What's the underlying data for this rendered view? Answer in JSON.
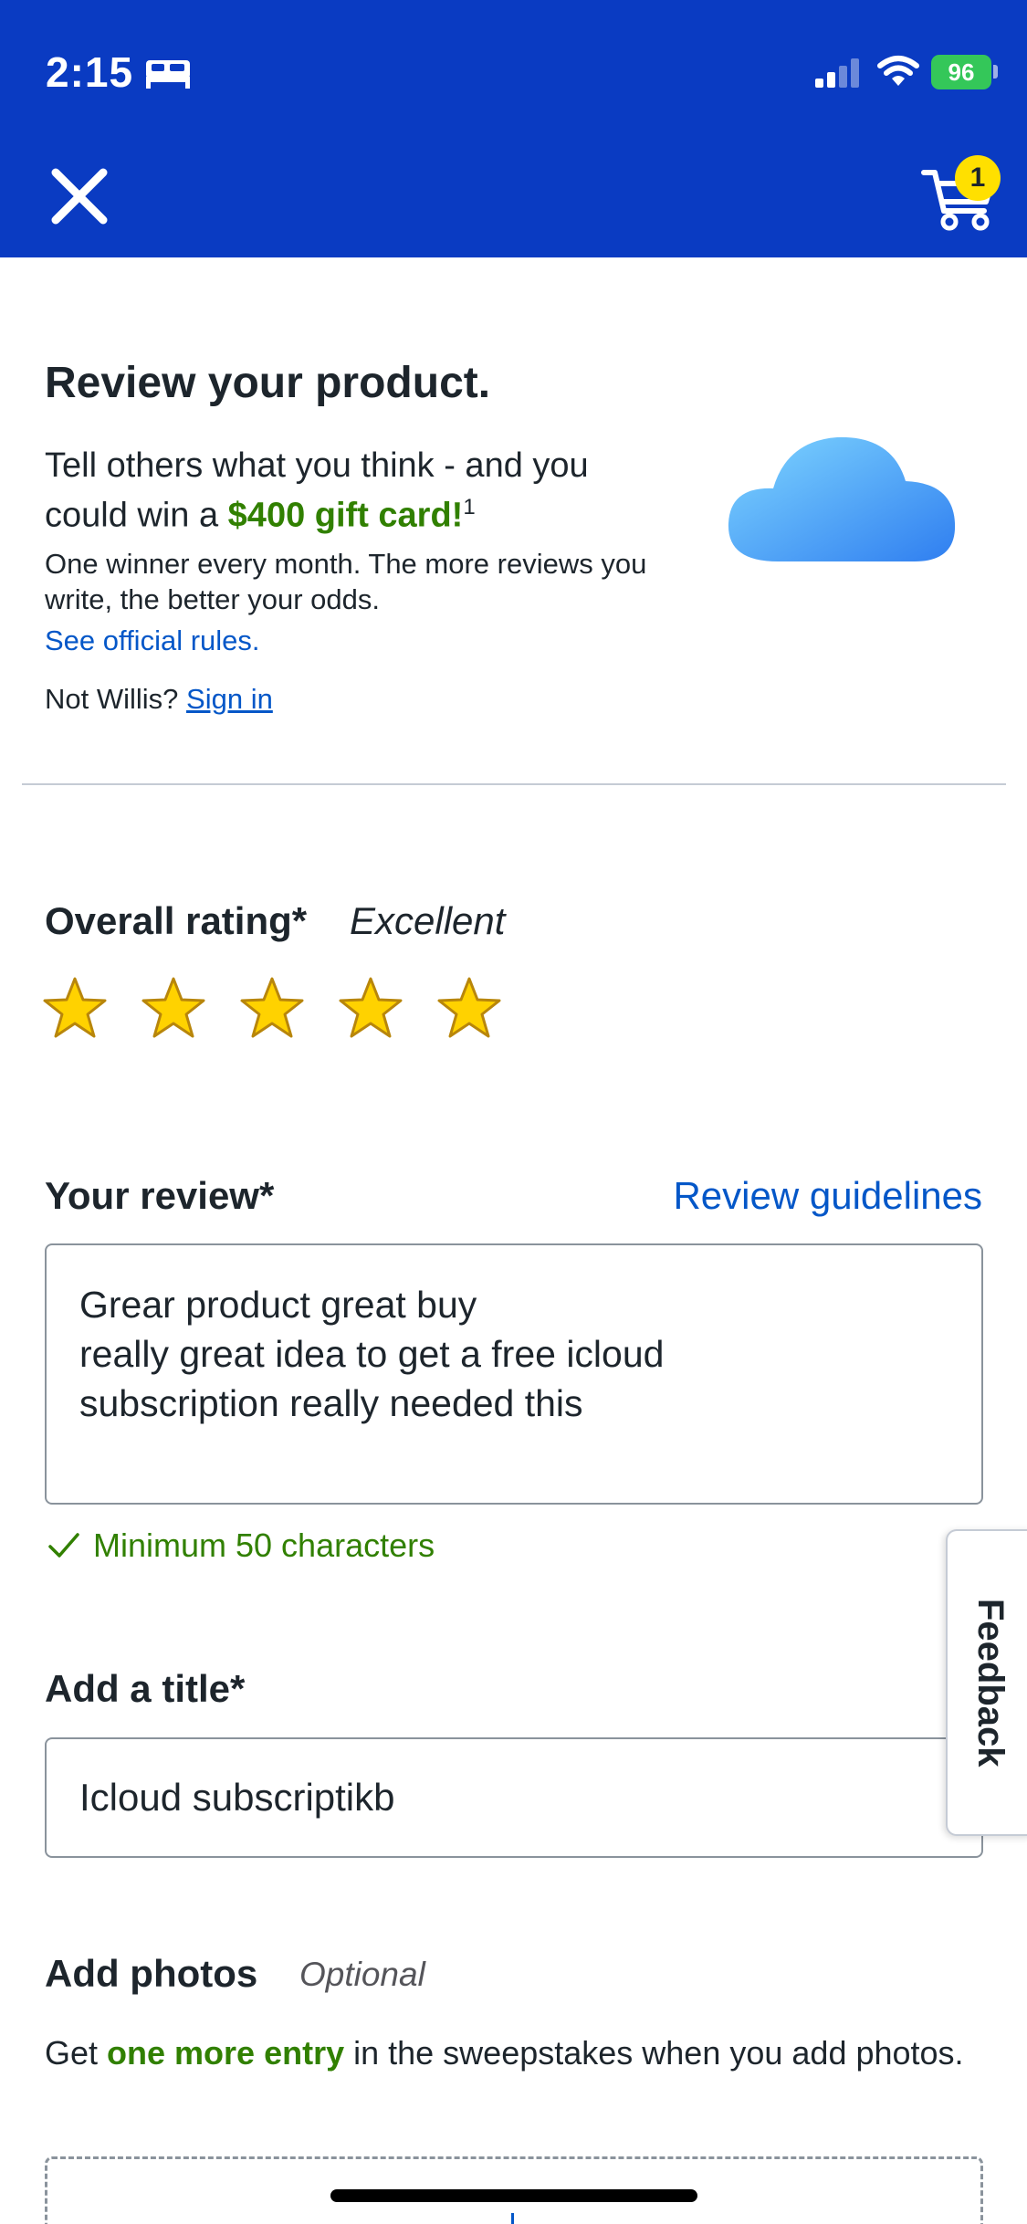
{
  "status_bar": {
    "time": "2:15",
    "battery": "96"
  },
  "header": {
    "cart_count": "1",
    "background": "#0a3bc2"
  },
  "intro": {
    "title": "Review your product.",
    "body_prefix": "Tell others what you think - and you could win a ",
    "body_highlight": "$400 gift card!",
    "body_sup": "1",
    "small": "One winner every month. The more reviews you write, the better your odds.",
    "rules_link": "See official rules.",
    "not_user_prefix": "Not Willis?",
    "sign_in": "Sign in"
  },
  "rating": {
    "label": "Overall rating*",
    "value_text": "Excellent",
    "stars": 5,
    "max_stars": 5
  },
  "review": {
    "label": "Your review*",
    "guidelines_link": "Review guidelines",
    "text": "Grear product great buy\nreally great idea to get a free icloud\nsubscription really needed this",
    "min_chars": "Minimum 50 characters"
  },
  "title_field": {
    "label": "Add a title*",
    "value": "Icloud subscriptikb"
  },
  "feedback": {
    "label": "Feedback"
  },
  "photos": {
    "label": "Add photos",
    "optional": "Optional",
    "body_prefix": "Get ",
    "body_highlight": "one more entry",
    "body_suffix": " in the sweepstakes when you add photos."
  },
  "icons": [
    "bed-icon",
    "signal-icon",
    "wifi-icon",
    "close-icon",
    "cart-icon",
    "cloud-icon",
    "star-icon",
    "check-icon"
  ],
  "colors": {
    "accent_blue": "#0a3bc2",
    "link": "#0457c8",
    "green": "#318000",
    "badge": "#ffe000",
    "star": "#ffd200"
  }
}
